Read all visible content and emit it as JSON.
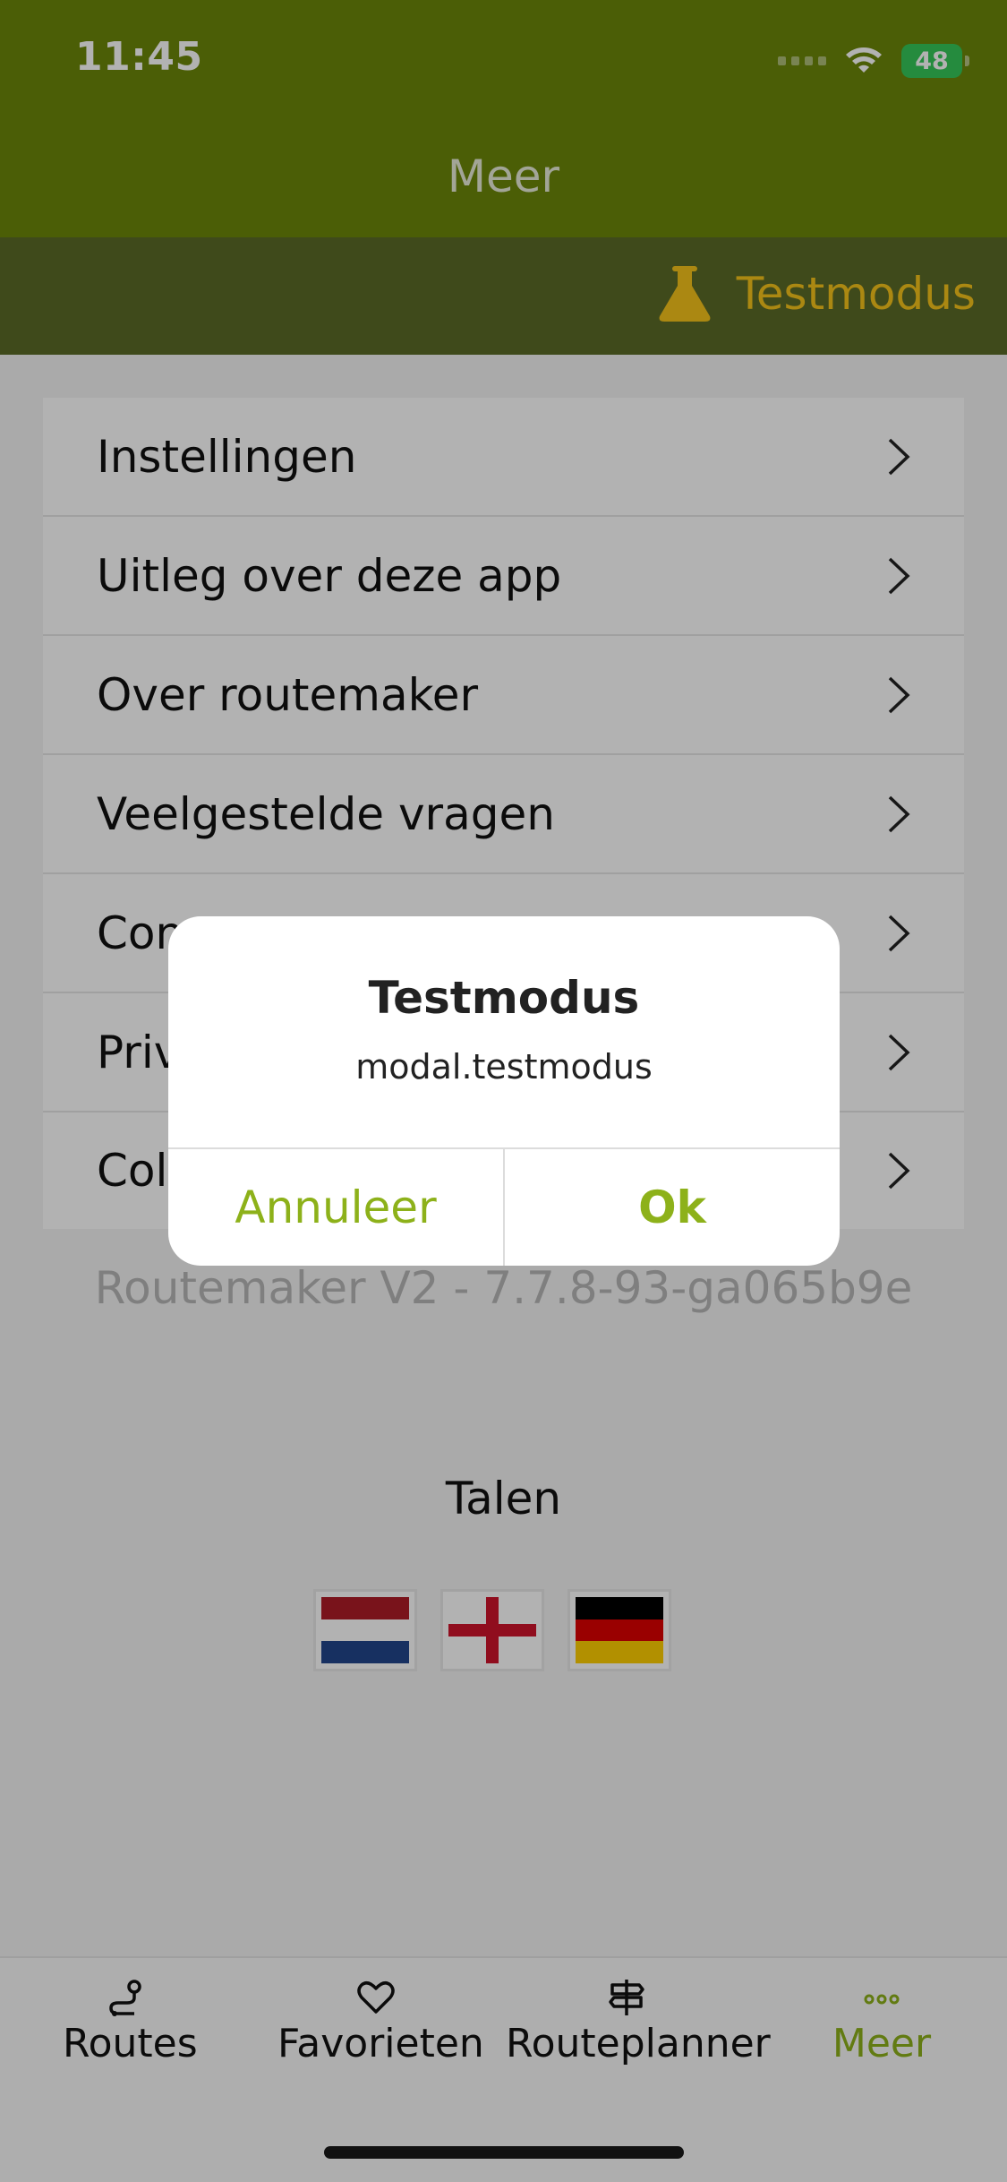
{
  "status_bar": {
    "time": "11:45",
    "battery": "48"
  },
  "header": {
    "title": "Meer"
  },
  "test_banner": {
    "label": "Testmodus",
    "icon": "flask-icon"
  },
  "menu": {
    "items": [
      {
        "label": "Instellingen"
      },
      {
        "label": "Uitleg over deze app"
      },
      {
        "label": "Over routemaker"
      },
      {
        "label": "Veelgestelde vragen"
      },
      {
        "label": "Con"
      },
      {
        "label": "Priv"
      },
      {
        "label": "Colo"
      }
    ]
  },
  "version": "Routemaker V2 - 7.7.8-93-ga065b9e",
  "languages": {
    "title": "Talen",
    "flags": [
      "nl-flag",
      "en-flag",
      "de-flag"
    ]
  },
  "tabbar": {
    "tabs": [
      {
        "label": "Routes",
        "icon": "routes-icon"
      },
      {
        "label": "Favorieten",
        "icon": "heart-icon"
      },
      {
        "label": "Routeplanner",
        "icon": "signpost-icon"
      },
      {
        "label": "Meer",
        "icon": "more-dots-icon",
        "active": true
      }
    ]
  },
  "dialog": {
    "title": "Testmodus",
    "message": "modal.testmodus",
    "cancel_label": "Annuleer",
    "ok_label": "Ok"
  },
  "colors": {
    "header": "#6c8709",
    "test_banner": "#5b6a28",
    "test_accent": "#f5c31b",
    "accent": "#8db11a"
  }
}
